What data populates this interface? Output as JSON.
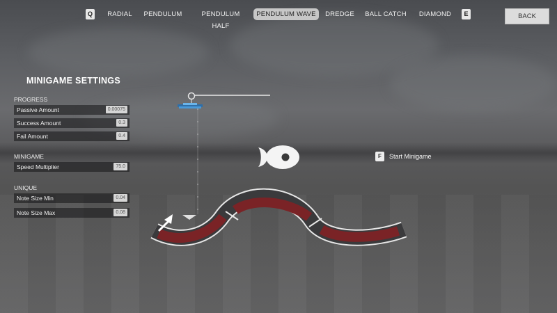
{
  "nav": {
    "left_key": "Q",
    "right_key": "E",
    "tabs": [
      {
        "label": "RADIAL",
        "active": false
      },
      {
        "label": "PENDULUM",
        "active": false
      },
      {
        "label": "PENDULUM HALF",
        "active": false
      },
      {
        "label": "PENDULUM WAVE",
        "active": true
      },
      {
        "label": "DREDGE",
        "active": false
      },
      {
        "label": "BALL CATCH",
        "active": false
      },
      {
        "label": "DIAMOND",
        "active": false
      }
    ],
    "back_label": "BACK"
  },
  "settings": {
    "title": "MINIGAME SETTINGS",
    "sections": [
      {
        "label": "PROGRESS",
        "rows": [
          {
            "label": "Passive Amount",
            "value": "0.00075"
          },
          {
            "label": "Success Amount",
            "value": "0.3"
          },
          {
            "label": "Fail Amount",
            "value": "0.4"
          }
        ]
      },
      {
        "label": "MINIGAME",
        "rows": [
          {
            "label": "Speed Multiplier",
            "value": "75.0"
          }
        ]
      },
      {
        "label": "UNIQUE",
        "rows": [
          {
            "label": "Note Size Min",
            "value": "0.04"
          },
          {
            "label": "Note Size Max",
            "value": "0.08"
          }
        ]
      }
    ]
  },
  "start": {
    "key": "F",
    "label": "Start Minigame"
  },
  "colors": {
    "track_fill": "#7a2326",
    "track_border": "#e6e6e6",
    "pendulum_weight": "#3d86c6",
    "active_tab_bg": "#c7c7c7"
  }
}
